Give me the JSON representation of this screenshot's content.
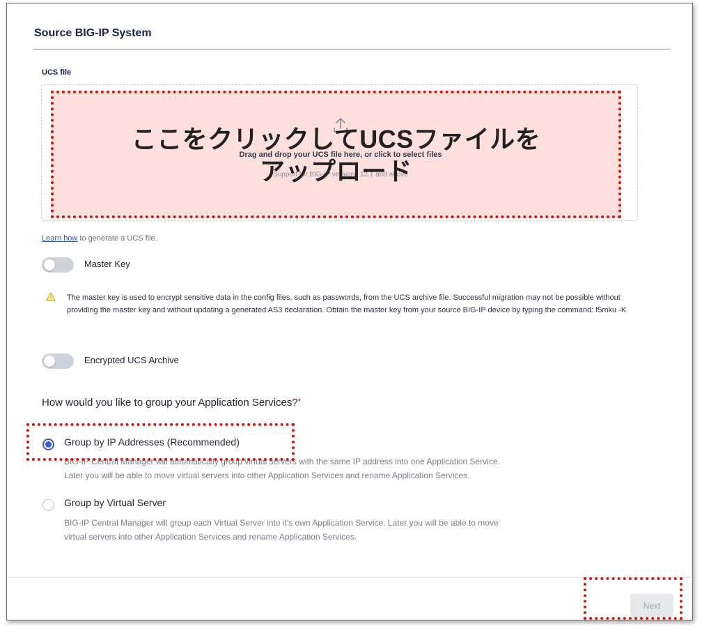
{
  "section": {
    "title": "Source BIG-IP System"
  },
  "ucs": {
    "label": "UCS file",
    "drop_main": "Drag and drop your UCS file here, or click to select files",
    "drop_sub": "Support for BIG-IP versions 12.1 and above",
    "overlay_line1": "ここをクリックしてUCSファイルを",
    "overlay_line2": "アップロード",
    "learn_link": "Learn how",
    "learn_rest": " to generate a UCS file."
  },
  "master_key": {
    "label": "Master Key",
    "on": false,
    "warning": "The master key is used to encrypt sensitive data in the config files, such as passwords, from the UCS archive file. Successful migration may not be possible without providing the master key and without updating a generated AS3 declaration. Obtain the master key from your source BIG-IP device by typing the command: f5mku -K"
  },
  "encrypted_archive": {
    "label": "Encrypted UCS Archive",
    "on": false
  },
  "grouping": {
    "question": "How would you like to group your Application Services?",
    "required_mark": "*",
    "options": [
      {
        "title": "Group by IP Addresses (Recommended)",
        "selected": true,
        "desc_line1": "BIG-IP Central Manager will automatically group virtual servers with the same IP address into one Application Service.",
        "desc_line2": "Later you will be able to move virtual servers into other Application Services and rename Application Services."
      },
      {
        "title": "Group by Virtual Server",
        "selected": false,
        "desc_line1": "BIG-IP Central Manager will group each Virtual Server into it’s own Application Service. Later you will be able to move",
        "desc_line2": "virtual servers into other Application Services and rename Application Services."
      }
    ]
  },
  "footer": {
    "next_label": "Next"
  },
  "colors": {
    "accent": "#3b5bdb",
    "annotation": "#d3180f",
    "annotation_fill": "#ffd6d2",
    "warning": "#e8b400"
  }
}
